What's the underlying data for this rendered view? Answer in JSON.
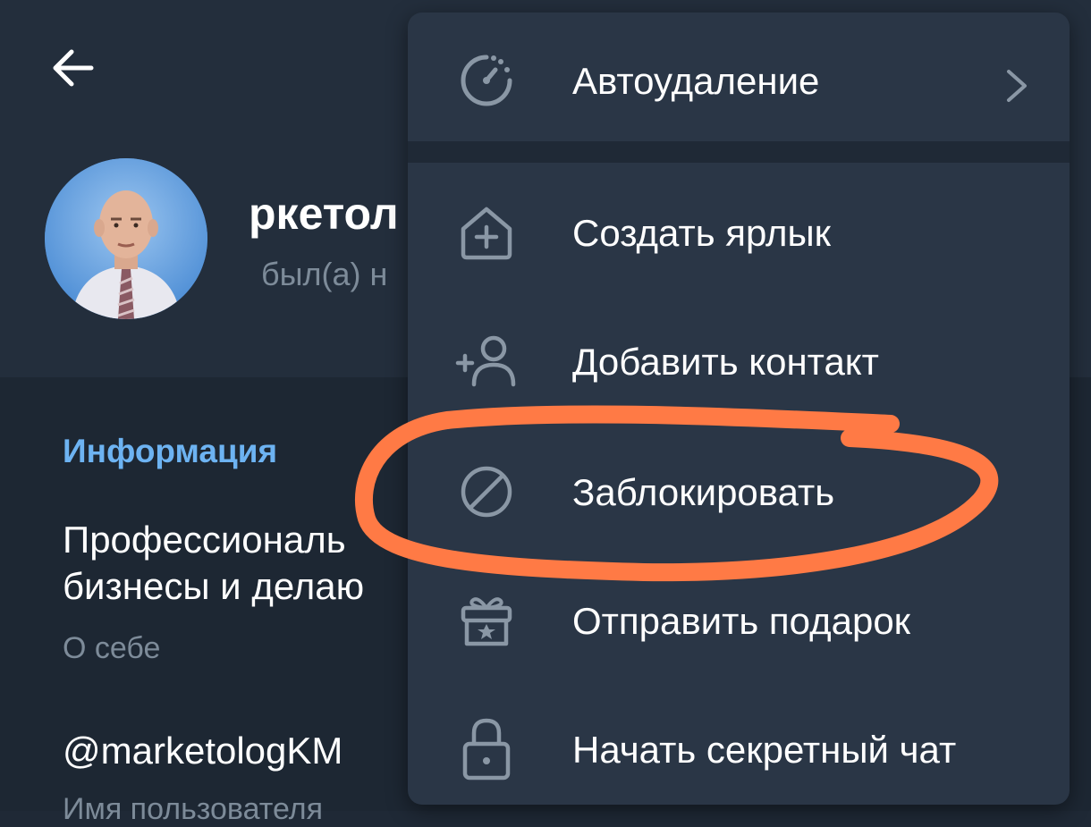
{
  "profile": {
    "name_partial": "ркетол",
    "status_partial": "был(а) н"
  },
  "info": {
    "section_title": "Информация",
    "bio_line1": "Профессиональ",
    "bio_line2": "бизнесы и делаю",
    "bio_label": "О себе",
    "username": "@marketologKM",
    "username_label": "Имя пользователя"
  },
  "menu": {
    "items": [
      {
        "label": "Автоудаление",
        "icon": "timer-icon",
        "has_chevron": true
      },
      {
        "label": "Создать ярлык",
        "icon": "add-shortcut-icon"
      },
      {
        "label": "Добавить контакт",
        "icon": "add-user-icon"
      },
      {
        "label": "Заблокировать",
        "icon": "block-icon"
      },
      {
        "label": "Отправить подарок",
        "icon": "gift-icon"
      },
      {
        "label": "Начать секретный чат",
        "icon": "lock-icon"
      }
    ]
  },
  "colors": {
    "background": "#1f2936",
    "header": "#232e3c",
    "menu": "#2a3646",
    "accent": "#6db3f2",
    "secondary_text": "#7d8b99",
    "icon": "#8a97a5",
    "annotation": "#ff7a45"
  }
}
